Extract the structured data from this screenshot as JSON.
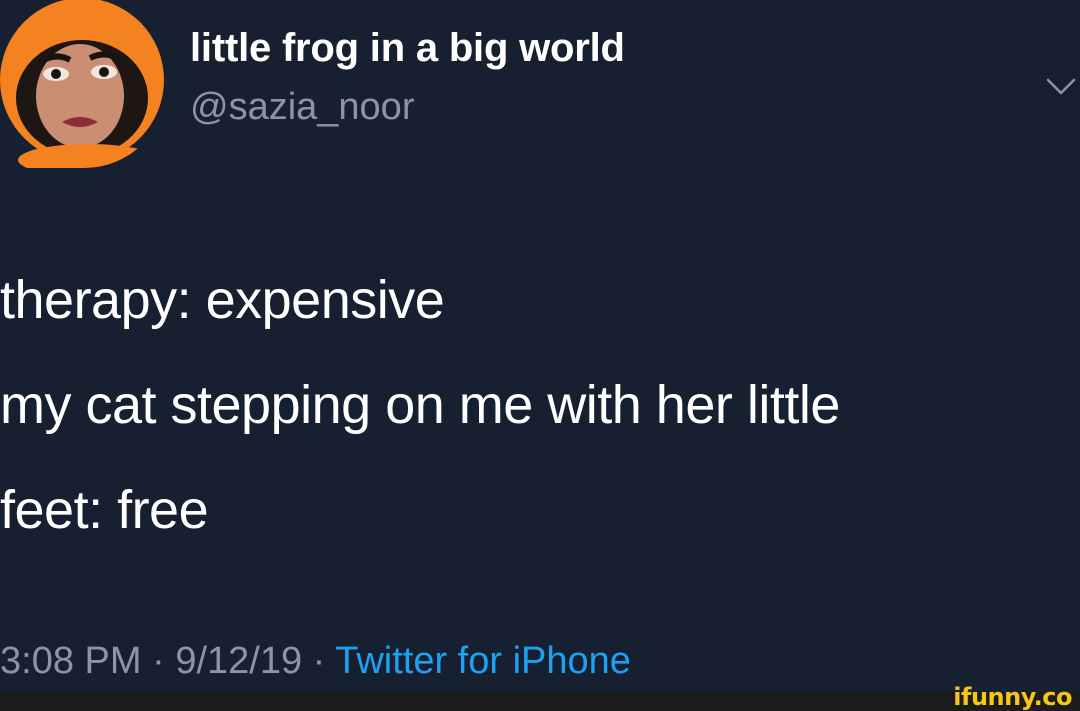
{
  "user": {
    "display_name": "little frog in a big world",
    "handle": "@sazia_noor"
  },
  "tweet": {
    "lines": [
      "therapy: expensive",
      "my cat stepping on me with her little",
      "feet: free"
    ]
  },
  "meta": {
    "time": "3:08 PM",
    "separator": "·",
    "date": "9/12/19",
    "source": "Twitter for iPhone"
  },
  "watermark": {
    "text": "ifunny.co"
  },
  "icons": {
    "menu": "chevron-down-icon"
  },
  "colors": {
    "background": "#162030",
    "text_primary": "#ffffff",
    "text_secondary": "#8a96a3",
    "link": "#1da1f2",
    "avatar_accent": "#f58220",
    "watermark": "#f6c619"
  }
}
